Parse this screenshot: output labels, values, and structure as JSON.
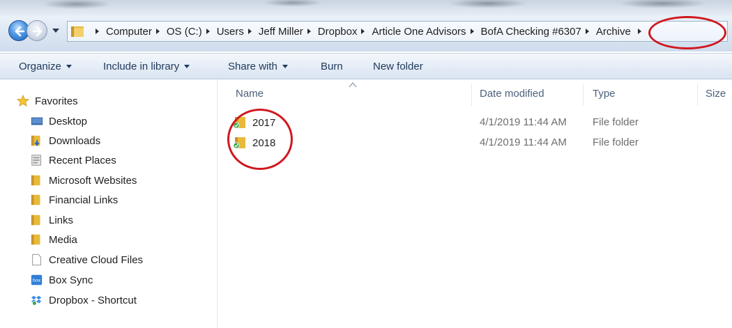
{
  "address_bar": {
    "crumbs": [
      "Computer",
      "OS (C:)",
      "Users",
      "Jeff Miller",
      "Dropbox",
      "Article One Advisors",
      "BofA Checking #6307",
      "Archive"
    ]
  },
  "toolbar": {
    "organize": "Organize",
    "include_in_library": "Include in library",
    "share_with": "Share with",
    "burn": "Burn",
    "new_folder": "New folder"
  },
  "nav_pane": {
    "favorites_label": "Favorites",
    "items": [
      {
        "label": "Desktop",
        "icon": "desktop-icon"
      },
      {
        "label": "Downloads",
        "icon": "downloads-folder-icon"
      },
      {
        "label": "Recent Places",
        "icon": "recent-places-icon"
      },
      {
        "label": "Microsoft Websites",
        "icon": "folder-icon"
      },
      {
        "label": "Financial Links",
        "icon": "folder-icon"
      },
      {
        "label": "Links",
        "icon": "folder-icon"
      },
      {
        "label": "Media",
        "icon": "folder-icon"
      },
      {
        "label": "Creative Cloud Files",
        "icon": "document-icon"
      },
      {
        "label": "Box Sync",
        "icon": "box-sync-icon"
      },
      {
        "label": "Dropbox - Shortcut",
        "icon": "dropbox-icon"
      }
    ]
  },
  "file_list": {
    "columns": {
      "name": "Name",
      "date_modified": "Date modified",
      "type": "Type",
      "size": "Size"
    },
    "rows": [
      {
        "name": "2017",
        "date_modified": "4/1/2019 11:44 AM",
        "type": "File folder",
        "icon": "synced-folder-icon"
      },
      {
        "name": "2018",
        "date_modified": "4/1/2019 11:44 AM",
        "type": "File folder",
        "icon": "synced-folder-icon"
      }
    ]
  },
  "colors": {
    "annotation_red": "#d0181f",
    "toolbar_text": "#1e395b",
    "folder_yellow": "#e8b93a",
    "sync_green": "#3aa847"
  }
}
